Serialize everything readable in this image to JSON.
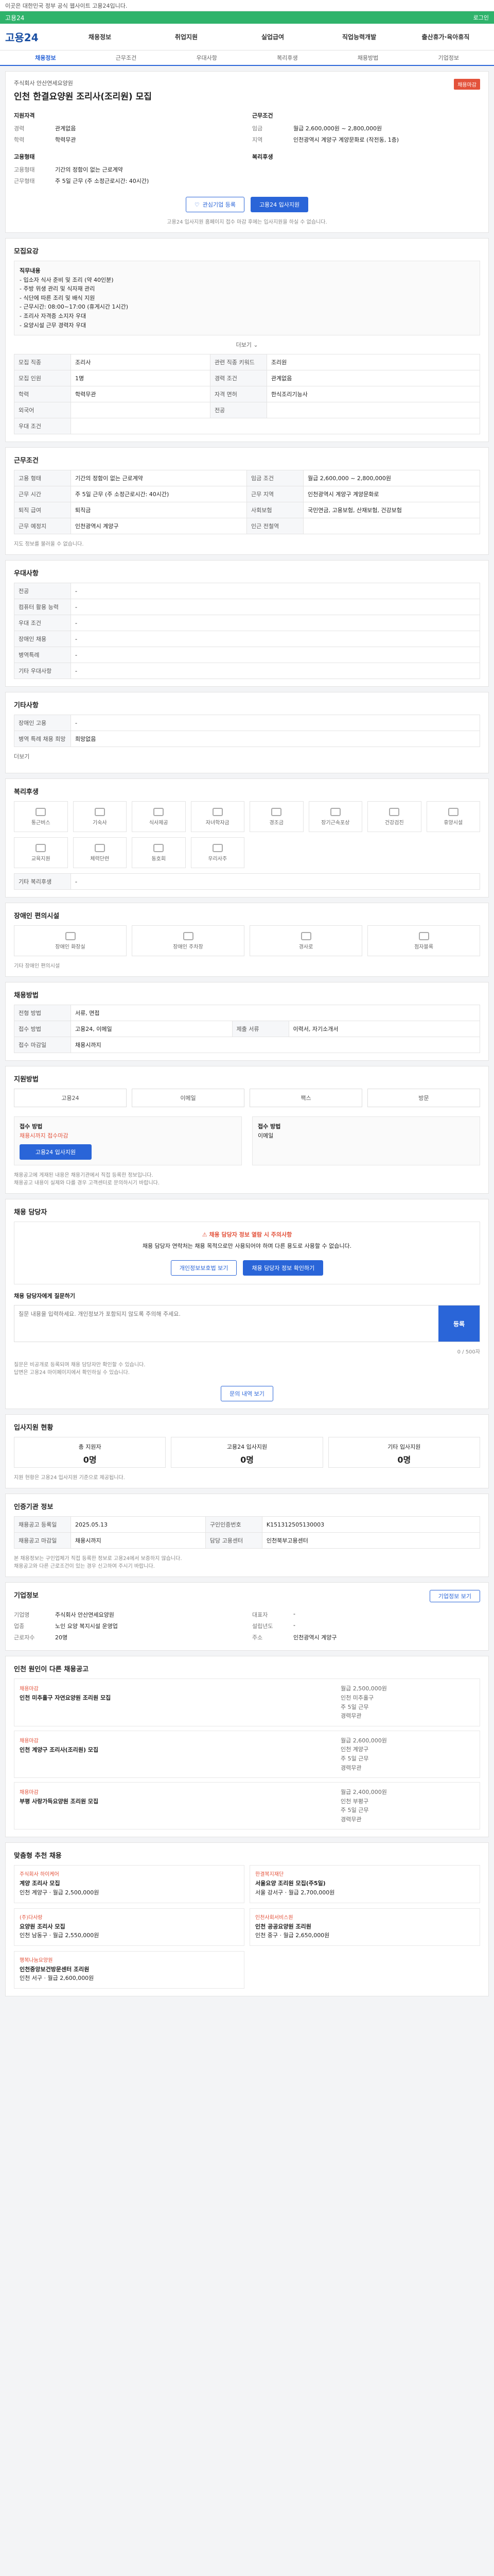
{
  "topbar": {
    "notice": "이곳은 대한민국 정부 공식 웹사이트 고용24입니다."
  },
  "brandbar": {
    "label": "고용24",
    "login": "로그인"
  },
  "gnb": {
    "logo": "고용24",
    "items": [
      "채용정보",
      "취업지원",
      "실업급여",
      "직업능력개발",
      "출산휴가·육아휴직"
    ]
  },
  "tabs": [
    {
      "label": "채용정보"
    },
    {
      "label": "근무조건"
    },
    {
      "label": "우대사항"
    },
    {
      "label": "복리후생"
    },
    {
      "label": "채용방법"
    },
    {
      "label": "기업정보"
    }
  ],
  "job": {
    "company": "주식회사 안산연세요양원",
    "title": "인천 한결요양원 조리사(조리원) 모집",
    "badge": "채용마감",
    "left_title": "지원자격",
    "left": [
      {
        "k": "경력",
        "v": "관계없음"
      },
      {
        "k": "학력",
        "v": "학력무관"
      },
      {
        "k": "",
        "v": ""
      }
    ],
    "left_title2": "고용형태",
    "left2": [
      {
        "k": "고용형태",
        "v": "기간의 정함이 없는 근로계약"
      },
      {
        "k": "근무형태",
        "v": "주 5일 근무 (주 소정근로시간: 40시간)"
      }
    ],
    "right_title": "근무조건",
    "right": [
      {
        "k": "임금",
        "v": "월급 2,600,000원 ~ 2,800,000원"
      },
      {
        "k": "지역",
        "v": "인천광역시 계양구 계양문화로 (작전동, 1층)"
      }
    ],
    "right_title2": "복리후생",
    "right2": [
      {
        "k": "",
        "v": ""
      }
    ],
    "btn_interest": "관심기업 등록",
    "btn_apply": "고용24 입사지원",
    "note": "고용24 입사지원 홈페이지 접수 마감 후에는 입사지원을 하실 수 없습니다."
  },
  "duty": {
    "title": "모집요강",
    "box": [
      "직무내용",
      "- 입소자 식사 준비 및 조리 (약 40인분)",
      "- 주방 위생 관리 및 식자재 관리",
      "- 식단에 따른 조리 및 배식 지원",
      "- 근무시간: 08:00~17:00 (휴게시간 1시간)",
      "- 조리사 자격증 소지자 우대",
      "- 요양시설 근무 경력자 우대"
    ],
    "more": "더보기",
    "rows": [
      {
        "h": "모집 직종",
        "v": "조리사",
        "h2": "관련 직종 키워드",
        "v2": "조리원"
      },
      {
        "h": "모집 인원",
        "v": "1명",
        "h2": "경력 조건",
        "v2": "관계없음"
      },
      {
        "h": "학력",
        "v": "학력무관",
        "h2": "자격 면허",
        "v2": "한식조리기능사"
      },
      {
        "h": "외국어",
        "v": "",
        "h2": "전공",
        "v2": ""
      },
      {
        "h": "우대 조건",
        "v": "",
        "h2": "",
        "v2": ""
      }
    ]
  },
  "conditions": {
    "title": "근무조건",
    "rows": [
      {
        "h": "고용 형태",
        "v": "기간의 정함이 없는 근로계약",
        "h2": "임금 조건",
        "v2": "월급 2,600,000 ~ 2,800,000원"
      },
      {
        "h": "근무 시간",
        "v": "주 5일 근무 (주 소정근로시간: 40시간)",
        "h2": "근무 지역",
        "v2": "인천광역시 계양구 계양문화로"
      },
      {
        "h": "퇴직 급여",
        "v": "퇴직금",
        "h2": "사회보험",
        "v2": "국민연금, 고용보험, 산재보험, 건강보험"
      },
      {
        "h": "근무 예정지",
        "v": "인천광역시 계양구",
        "h2": "인근 전철역",
        "v2": ""
      }
    ],
    "map_note": "지도 정보를 불러올 수 없습니다."
  },
  "prefer": {
    "title": "우대사항",
    "rows": [
      {
        "h": "전공",
        "v": "-"
      },
      {
        "h": "컴퓨터 활용 능력",
        "v": "-"
      },
      {
        "h": "우대 조건",
        "v": "-"
      },
      {
        "h": "장애인 채용",
        "v": "-"
      },
      {
        "h": "병역특례",
        "v": "-"
      },
      {
        "h": "기타 우대사항",
        "v": "-"
      }
    ]
  },
  "etc": {
    "title": "기타사항",
    "rows": [
      {
        "h": "장애인 고용",
        "v": "-"
      },
      {
        "h": "병역 특례 채용 희망",
        "v": "희망없음"
      }
    ],
    "more": "더보기"
  },
  "welfare": {
    "title": "복리후생",
    "icons": [
      "통근버스",
      "기숙사",
      "식사제공",
      "자녀학자금",
      "경조금",
      "장기근속포상",
      "건강검진",
      "휴양시설",
      "교육지원",
      "체력단련",
      "동호회",
      "우리사주"
    ],
    "extra_title": "기타 복리후생",
    "extra": "-"
  },
  "disabled": {
    "title": "장애인 편의시설",
    "icons": [
      "장애인 화장실",
      "장애인 주차장",
      "경사로",
      "점자블록"
    ],
    "note": "기타 장애인 편의시설"
  },
  "process": {
    "title": "채용방법",
    "rows": [
      {
        "h": "전형 방법",
        "v": "서류, 면접",
        "h2": "",
        "v2": ""
      },
      {
        "h": "접수 방법",
        "v": "고용24, 이메일",
        "h2": "제출 서류",
        "v2": "이력서, 자기소개서"
      },
      {
        "h": "접수 마감일",
        "v": "채용시까지",
        "h2": "",
        "v2": ""
      }
    ]
  },
  "apply": {
    "title": "지원방법",
    "methods": [
      "고용24",
      "이메일",
      "팩스",
      "방문"
    ],
    "left_title": "접수 방법",
    "left_sub": "채용시까지 접수마감",
    "btn": "고용24 입사지원",
    "right_title": "접수 방법",
    "right_sub": "이메일",
    "notes": [
      "채용공고에 게재된 내용은 채용기관에서 직접 등록한 정보입니다.",
      "채용공고 내용이 실제와 다를 경우 고객센터로 문의하시기 바랍니다."
    ]
  },
  "contact": {
    "title": "채용 담당자",
    "alert": "채용 담당자 정보 열람 시 주의사항",
    "alert_desc": "채용 담당자 연락처는 채용 목적으로만 사용되어야 하며 다른 용도로 사용할 수 없습니다.",
    "btn1": "개인정보보호법 보기",
    "btn2": "채용 담당자 정보 확인하기",
    "qa_title": "채용 담당자에게 질문하기",
    "qa_placeholder": "질문 내용을 입력하세요. 개인정보가 포함되지 않도록 주의해 주세요.",
    "qa_btn": "등록",
    "qa_count": "0 / 500자",
    "qa_notes": [
      "질문은 비공개로 등록되며 채용 담당자만 확인할 수 있습니다.",
      "답변은 고용24 마이페이지에서 확인하실 수 있습니다."
    ],
    "qa_more": "문의 내역 보기"
  },
  "stats": {
    "title": "입사지원 현황",
    "items": [
      {
        "label": "총 지원자",
        "value": "0명"
      },
      {
        "label": "고용24 입사지원",
        "value": "0명"
      },
      {
        "label": "기타 입사지원",
        "value": "0명"
      }
    ],
    "note": "지원 현황은 고용24 입사지원 기준으로 제공됩니다."
  },
  "info": {
    "title": "인증기관 정보",
    "rows": [
      {
        "h": "채용공고 등록일",
        "v": "2025.05.13",
        "h2": "구인인증번호",
        "v2": "K151312505130003"
      },
      {
        "h": "채용공고 마감일",
        "v": "채용시까지",
        "h2": "담당 고용센터",
        "v2": "인천북부고용센터"
      }
    ],
    "notes": [
      "본 채용정보는 구인업체가 직접 등록한 정보로 고용24에서 보증하지 않습니다.",
      "채용공고와 다른 근로조건이 있는 경우 신고하여 주시기 바랍니다."
    ]
  },
  "company": {
    "title": "기업정보",
    "btn": "기업정보 보기",
    "rows": [
      {
        "k": "기업명",
        "v": "주식회사 안산연세요양원"
      },
      {
        "k": "업종",
        "v": "노인 요양 복지시설 운영업"
      },
      {
        "k": "근로자수",
        "v": "20명"
      },
      {
        "k": "대표자",
        "v": "-"
      },
      {
        "k": "설립년도",
        "v": "-"
      },
      {
        "k": "주소",
        "v": "인천광역시 계양구"
      }
    ]
  },
  "others": {
    "title": "인천 원인이 다른 채용공고",
    "items": [
      {
        "tag": "채용마감",
        "name": "인천 미추홀구 자연요양원 조리원 모집",
        "meta": [
          "월급 2,500,000원",
          "인천 미추홀구",
          "주 5일 근무",
          "경력무관"
        ]
      },
      {
        "tag": "채용마감",
        "name": "인천 계양구 조리사(조리원) 모집",
        "meta": [
          "월급 2,600,000원",
          "인천 계양구",
          "주 5일 근무",
          "경력무관"
        ]
      },
      {
        "tag": "채용마감",
        "name": "부평 사랑가득요양원 조리원 모집",
        "meta": [
          "월급 2,400,000원",
          "인천 부평구",
          "주 5일 근무",
          "경력무관"
        ]
      }
    ]
  },
  "rec": {
    "title": "맞춤형 추천 채용",
    "items": [
      {
        "co": "주식회사 하이케어",
        "name": "계양 조리사 모집",
        "meta": "인천 계양구 · 월급 2,500,000원"
      },
      {
        "co": "한결복지재단",
        "name": "서울요양 조리원 모집(주5일)",
        "meta": "서울 강서구 · 월급 2,700,000원"
      },
      {
        "co": "(주)다사랑",
        "name": "요양원 조리사 모집",
        "meta": "인천 남동구 · 월급 2,550,000원"
      },
      {
        "co": "인천사회서비스원",
        "name": "인천 공공요양원 조리원",
        "meta": "인천 중구 · 월급 2,650,000원"
      },
      {
        "co": "행복나눔요양원",
        "name": "인천중앙보건방문센터 조리원",
        "meta": "인천 서구 · 월급 2,600,000원"
      }
    ]
  }
}
